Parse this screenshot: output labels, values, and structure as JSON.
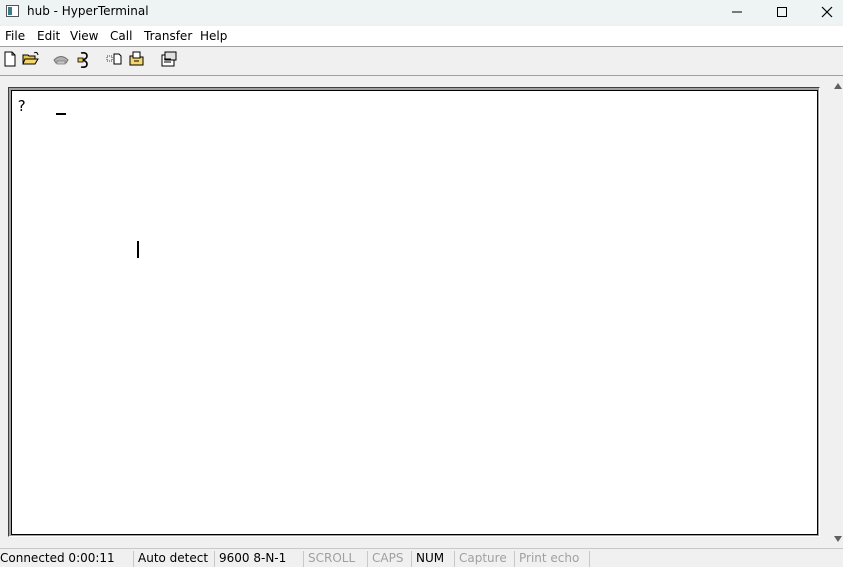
{
  "window": {
    "title": "hub - HyperTerminal",
    "minimize_icon": "minimize-icon",
    "maximize_icon": "maximize-icon",
    "close_icon": "close-icon"
  },
  "menu": {
    "items": [
      "File",
      "Edit",
      "View",
      "Call",
      "Transfer",
      "Help"
    ]
  },
  "toolbar": {
    "buttons": [
      "new-document-icon",
      "open-folder-icon",
      "call-phone-icon",
      "disconnect-phone-icon",
      "send-file-icon",
      "receive-file-icon",
      "properties-icon"
    ]
  },
  "terminal": {
    "text": "?"
  },
  "statusbar": {
    "connected": "Connected 0:00:11",
    "detect": "Auto detect",
    "settings": "9600 8-N-1",
    "scroll": "SCROLL",
    "caps": "CAPS",
    "num": "NUM",
    "capture": "Capture",
    "print_echo": "Print echo"
  }
}
